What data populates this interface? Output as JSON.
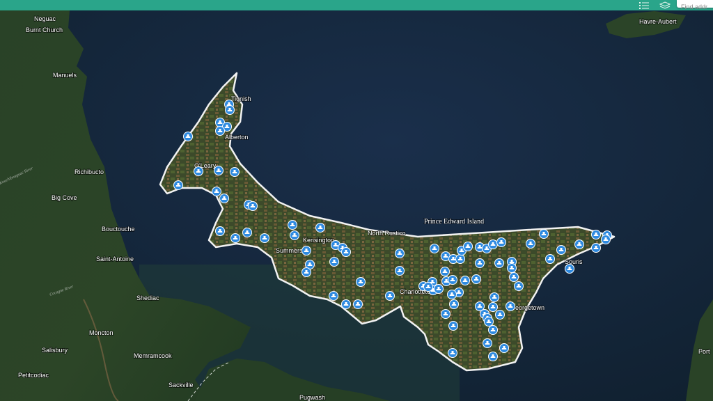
{
  "toolbar": {
    "search_placeholder": "Find addr",
    "list_icon": "list-icon",
    "layers_icon": "layers-icon"
  },
  "colors": {
    "header": "#2aa58a",
    "water": "#15263c",
    "land": "#2a4226",
    "outline": "#f2f2f2",
    "marker": "#2e8ae0"
  },
  "region_label": "Prince Edward Island",
  "places": [
    "Neguac",
    "Burnt Church",
    "Manuels",
    "Richibucto",
    "Big Cove",
    "Bouctouche",
    "Saint-Antoine",
    "Shediac",
    "Moncton",
    "Memramcook",
    "Salisbury",
    "Petitcodiac",
    "Sackville",
    "Pugwash",
    "Havre-Aubert",
    "Port",
    "Tignish",
    "Alberton",
    "O'Leary",
    "Kensington",
    "Summerside",
    "North Rustico",
    "Charlottetown",
    "Georgetown",
    "Souris"
  ],
  "rivers": [
    "Kouchibouguac River",
    "Cocagne River"
  ],
  "marker_icon": "site-marker-icon",
  "marker_count": 89
}
